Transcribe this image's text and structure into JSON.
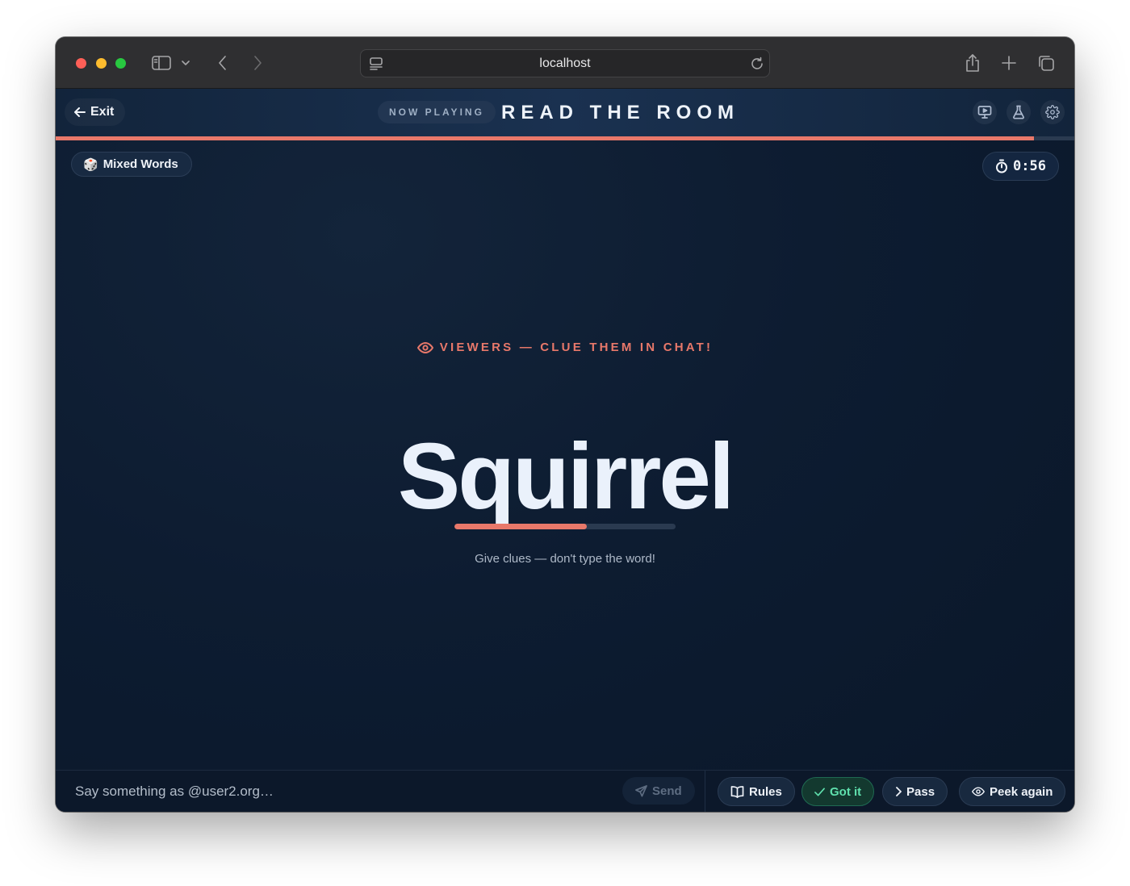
{
  "browser": {
    "url": "localhost"
  },
  "header": {
    "exit_label": "Exit",
    "now_playing_label": "NOW PLAYING",
    "game_title": "READ THE ROOM",
    "round_progress": 0.96
  },
  "game": {
    "mode_label": "Mixed Words",
    "timer": "0:56",
    "viewers_prompt": "VIEWERS — CLUE THEM IN CHAT!",
    "secret_word": "Squirrel",
    "word_progress": 0.6,
    "hint": "Give clues — don't type the word!"
  },
  "chat": {
    "placeholder": "Say something as @user2.org…",
    "send_label": "Send"
  },
  "actions": {
    "rules_label": "Rules",
    "got_it_label": "Got it",
    "pass_label": "Pass",
    "peek_label": "Peek again"
  },
  "colors": {
    "accent": "#e8786a",
    "success": "#5fe0ad",
    "background": "#0c1a2e"
  }
}
